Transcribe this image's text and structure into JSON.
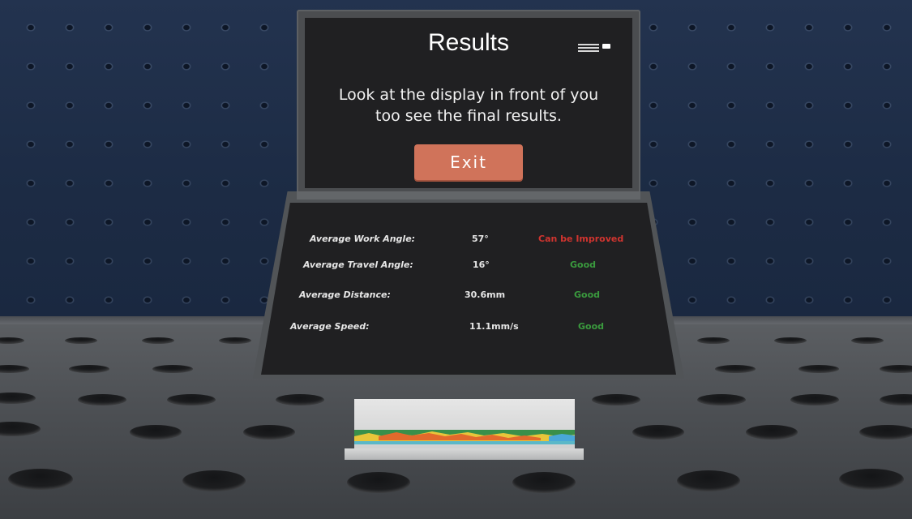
{
  "top_display": {
    "title": "Results",
    "instructions_line1": "Look at the display in front of you",
    "instructions_line2": "too see the final results.",
    "exit_label": "Exit"
  },
  "results_table": {
    "rows": [
      {
        "label": "Average Work Angle:",
        "value": "57°",
        "status": "Can be Improved",
        "status_color": "#d0342f"
      },
      {
        "label": "Average Travel Angle:",
        "value": "16°",
        "status": "Good",
        "status_color": "#3a9a3e"
      },
      {
        "label": "Average Distance:",
        "value": "30.6mm",
        "status": "Good",
        "status_color": "#3a9a3e"
      },
      {
        "label": "Average Speed:",
        "value": "11.1mm/s",
        "status": "Good",
        "status_color": "#3a9a3e"
      }
    ]
  },
  "colors": {
    "exit_button": "#d0735a",
    "screen_background": "#202022",
    "good": "#3a9a3e",
    "can_be_improved": "#d0342f"
  },
  "icons": {
    "logo": "brand-logo-icon"
  }
}
